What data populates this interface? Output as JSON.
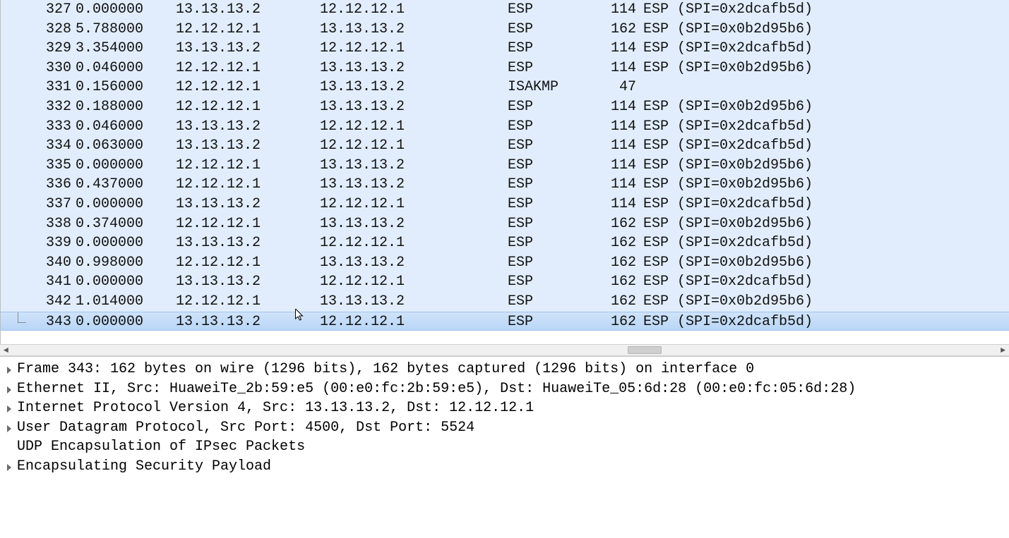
{
  "packets": [
    {
      "no": "327",
      "time": "0.000000",
      "src": "13.13.13.2",
      "dst": "12.12.12.1",
      "proto": "ESP",
      "len": "114",
      "info": "ESP (SPI=0x2dcafb5d)"
    },
    {
      "no": "328",
      "time": "5.788000",
      "src": "12.12.12.1",
      "dst": "13.13.13.2",
      "proto": "ESP",
      "len": "162",
      "info": "ESP (SPI=0x0b2d95b6)"
    },
    {
      "no": "329",
      "time": "3.354000",
      "src": "13.13.13.2",
      "dst": "12.12.12.1",
      "proto": "ESP",
      "len": "114",
      "info": "ESP (SPI=0x2dcafb5d)"
    },
    {
      "no": "330",
      "time": "0.046000",
      "src": "12.12.12.1",
      "dst": "13.13.13.2",
      "proto": "ESP",
      "len": "114",
      "info": "ESP (SPI=0x0b2d95b6)"
    },
    {
      "no": "331",
      "time": "0.156000",
      "src": "12.12.12.1",
      "dst": "13.13.13.2",
      "proto": "ISAKMP",
      "len": "47",
      "info": ""
    },
    {
      "no": "332",
      "time": "0.188000",
      "src": "12.12.12.1",
      "dst": "13.13.13.2",
      "proto": "ESP",
      "len": "114",
      "info": "ESP (SPI=0x0b2d95b6)"
    },
    {
      "no": "333",
      "time": "0.046000",
      "src": "13.13.13.2",
      "dst": "12.12.12.1",
      "proto": "ESP",
      "len": "114",
      "info": "ESP (SPI=0x2dcafb5d)"
    },
    {
      "no": "334",
      "time": "0.063000",
      "src": "13.13.13.2",
      "dst": "12.12.12.1",
      "proto": "ESP",
      "len": "114",
      "info": "ESP (SPI=0x2dcafb5d)"
    },
    {
      "no": "335",
      "time": "0.000000",
      "src": "12.12.12.1",
      "dst": "13.13.13.2",
      "proto": "ESP",
      "len": "114",
      "info": "ESP (SPI=0x0b2d95b6)"
    },
    {
      "no": "336",
      "time": "0.437000",
      "src": "12.12.12.1",
      "dst": "13.13.13.2",
      "proto": "ESP",
      "len": "114",
      "info": "ESP (SPI=0x0b2d95b6)"
    },
    {
      "no": "337",
      "time": "0.000000",
      "src": "13.13.13.2",
      "dst": "12.12.12.1",
      "proto": "ESP",
      "len": "114",
      "info": "ESP (SPI=0x2dcafb5d)"
    },
    {
      "no": "338",
      "time": "0.374000",
      "src": "12.12.12.1",
      "dst": "13.13.13.2",
      "proto": "ESP",
      "len": "162",
      "info": "ESP (SPI=0x0b2d95b6)"
    },
    {
      "no": "339",
      "time": "0.000000",
      "src": "13.13.13.2",
      "dst": "12.12.12.1",
      "proto": "ESP",
      "len": "162",
      "info": "ESP (SPI=0x2dcafb5d)"
    },
    {
      "no": "340",
      "time": "0.998000",
      "src": "12.12.12.1",
      "dst": "13.13.13.2",
      "proto": "ESP",
      "len": "162",
      "info": "ESP (SPI=0x0b2d95b6)"
    },
    {
      "no": "341",
      "time": "0.000000",
      "src": "13.13.13.2",
      "dst": "12.12.12.1",
      "proto": "ESP",
      "len": "162",
      "info": "ESP (SPI=0x2dcafb5d)"
    },
    {
      "no": "342",
      "time": "1.014000",
      "src": "12.12.12.1",
      "dst": "13.13.13.2",
      "proto": "ESP",
      "len": "162",
      "info": "ESP (SPI=0x0b2d95b6)"
    },
    {
      "no": "343",
      "time": "0.000000",
      "src": "13.13.13.2",
      "dst": "12.12.12.1",
      "proto": "ESP",
      "len": "162",
      "info": "ESP (SPI=0x2dcafb5d)",
      "selected": true,
      "last": true
    }
  ],
  "details": [
    {
      "text": "Frame 343: 162 bytes on wire (1296 bits), 162 bytes captured (1296 bits) on interface 0",
      "expandable": true
    },
    {
      "text": "Ethernet II, Src: HuaweiTe_2b:59:e5 (00:e0:fc:2b:59:e5), Dst: HuaweiTe_05:6d:28 (00:e0:fc:05:6d:28)",
      "expandable": true
    },
    {
      "text": "Internet Protocol Version 4, Src: 13.13.13.2, Dst: 12.12.12.1",
      "expandable": true
    },
    {
      "text": "User Datagram Protocol, Src Port: 4500, Dst Port: 5524",
      "expandable": true
    },
    {
      "text": "UDP Encapsulation of IPsec Packets",
      "expandable": false
    },
    {
      "text": "Encapsulating Security Payload",
      "expandable": true
    }
  ],
  "scroll": {
    "left_glyph": "◄",
    "right_glyph": "►"
  }
}
